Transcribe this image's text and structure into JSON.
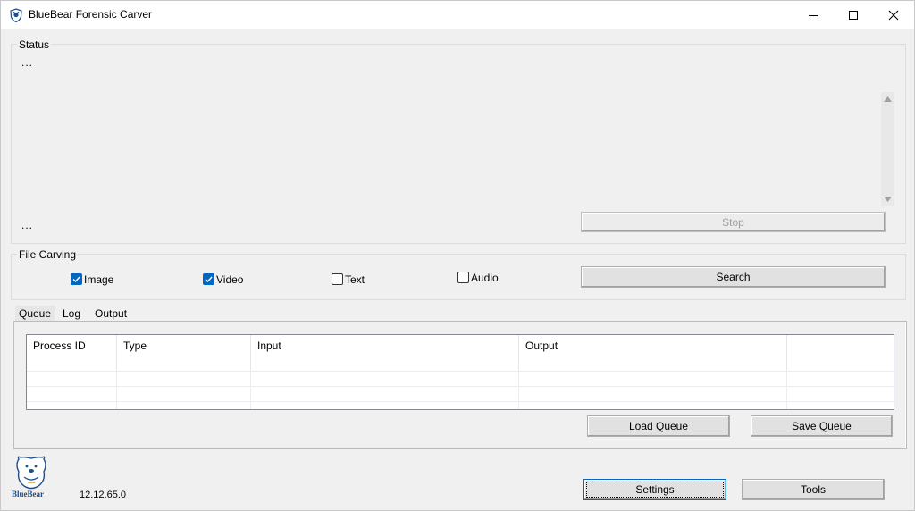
{
  "window": {
    "title": "BlueBear Forensic Carver",
    "controls": {
      "minimize": "minimize-icon",
      "maximize": "maximize-icon",
      "close": "close-icon"
    }
  },
  "status": {
    "group_label": "Status",
    "line_top": "...",
    "line_bottom": "...",
    "stop_label": "Stop"
  },
  "file_carving": {
    "group_label": "File Carving",
    "options": [
      {
        "label": "Image",
        "checked": true
      },
      {
        "label": "Video",
        "checked": true
      },
      {
        "label": "Text",
        "checked": false
      },
      {
        "label": "Audio",
        "checked": false
      }
    ],
    "search_label": "Search"
  },
  "tabs": [
    {
      "label": "Queue",
      "active": true
    },
    {
      "label": "Log",
      "active": false
    },
    {
      "label": "Output",
      "active": false
    }
  ],
  "queue_table": {
    "columns": [
      "Process ID",
      "Type",
      "Input",
      "Output",
      ""
    ],
    "rows": []
  },
  "queue_buttons": {
    "load_label": "Load Queue",
    "save_label": "Save Queue"
  },
  "footer": {
    "logo_text": "BlueBear",
    "version": "12.12.65.0",
    "settings_label": "Settings",
    "tools_label": "Tools"
  },
  "colors": {
    "accent": "#0067c0",
    "logo_blue": "#1f4e8c",
    "logo_gold": "#c9a13b"
  }
}
